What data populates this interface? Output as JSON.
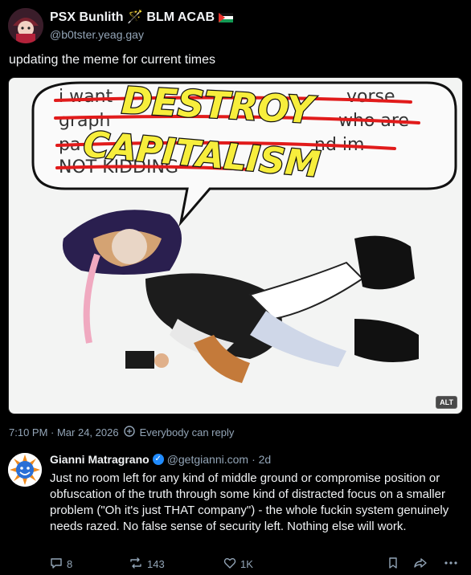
{
  "post": {
    "display_name": "PSX Bunlith 🪄 BLM ACAB",
    "handle": "@b0tster.yeag.gay",
    "text": "updating the meme for current times",
    "image": {
      "bubble_text_lines": [
        "i want",
        "vorse",
        "graph",
        "who are",
        "pa",
        "nd im",
        "NOT KIDDING"
      ],
      "overlay_line1": "DESTROY",
      "overlay_line2": "CAPITALISM",
      "alt_label": "ALT"
    },
    "timestamp": "7:10 PM · Mar 24, 2026",
    "reply_setting": "Everybody can reply"
  },
  "reply": {
    "display_name": "Gianni Matragrano",
    "handle": "@getgianni.com",
    "age": "· 2d",
    "text": "Just no room left for any kind of middle ground or compromise position or obfuscation of the truth through some kind of distracted focus on a smaller problem (\"Oh it's just THAT company\") - the whole fuckin system genuinely needs razed. No false sense of security left. Nothing else will work.",
    "reply_count": "8",
    "repost_count": "143",
    "like_count": "1K"
  },
  "icons": {
    "verified": "verified-check-icon",
    "reply": "reply-icon",
    "repost": "repost-icon",
    "like": "heart-icon",
    "bookmark": "bookmark-icon",
    "share": "share-icon",
    "more": "more-icon"
  },
  "colors": {
    "background": "#000000",
    "muted": "#93a5b7",
    "verified": "#208bfe",
    "meme_yellow": "#f7ee3c",
    "meme_red": "#e11b1b"
  }
}
